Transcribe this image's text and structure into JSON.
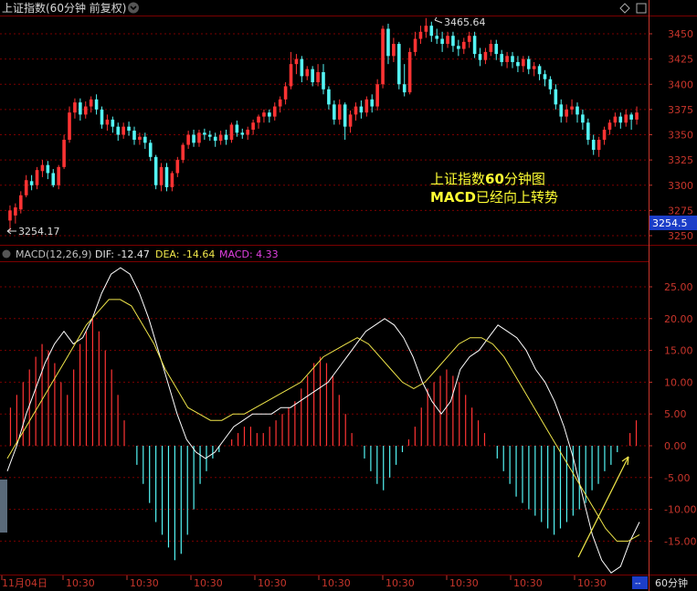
{
  "header": {
    "title": "上证指数(60分钟 前复权)",
    "menu_icon": "chevron-down-icon",
    "diamond_icon": "diamond-icon",
    "box_icon": "square-icon"
  },
  "colors": {
    "up": "#ff3333",
    "down": "#54f5f5",
    "grid": "#7a0000",
    "axis_text": "#c8352b",
    "dif": "#ffffff",
    "dea": "#f0e64a",
    "macd": "#e040e0",
    "annotation": "#ffff33"
  },
  "price_panel": {
    "high_label": "3465.64",
    "low_label": "3254.17",
    "current_price": "3254.5",
    "y_ticks": [
      "3450",
      "3425",
      "3400",
      "3375",
      "3350",
      "3325",
      "3300",
      "3275",
      "3250"
    ]
  },
  "annotation": {
    "line1": "上证指数",
    "line1_bold": "60",
    "line1_end": "分钟图",
    "line2_bold": "MACD",
    "line2_end": "已经向上转势"
  },
  "macd_panel": {
    "title": "MACD(12,26,9)",
    "dif_label": "DIF: -12.47",
    "dea_label": "DEA: -14.64",
    "macd_label": "MACD: 4.33",
    "y_ticks": [
      "25.00",
      "20.00",
      "15.00",
      "10.00",
      "5.00",
      "0.00",
      "-5.00",
      "-10.00",
      "-15.00"
    ]
  },
  "time_axis": {
    "labels": [
      "11月04日",
      "10:30",
      "10:30",
      "10:30",
      "10:30",
      "10:30",
      "10:30",
      "10:30",
      "10:30",
      "10:30"
    ],
    "period": "60分钟"
  },
  "chart_data": [
    {
      "type": "candlestick",
      "title": "上证指数(60分钟 前复权)",
      "ylim": [
        3245,
        3470
      ],
      "candles": [
        [
          3265,
          3275,
          3255,
          3280
        ],
        [
          3270,
          3278,
          3262,
          3282
        ],
        [
          3276,
          3290,
          3272,
          3294
        ],
        [
          3290,
          3305,
          3288,
          3310
        ],
        [
          3304,
          3300,
          3295,
          3310
        ],
        [
          3300,
          3315,
          3296,
          3318
        ],
        [
          3314,
          3320,
          3308,
          3325
        ],
        [
          3320,
          3312,
          3306,
          3324
        ],
        [
          3312,
          3300,
          3298,
          3316
        ],
        [
          3300,
          3318,
          3296,
          3320
        ],
        [
          3318,
          3345,
          3316,
          3350
        ],
        [
          3345,
          3372,
          3342,
          3378
        ],
        [
          3372,
          3382,
          3366,
          3386
        ],
        [
          3382,
          3370,
          3364,
          3386
        ],
        [
          3370,
          3378,
          3366,
          3383
        ],
        [
          3378,
          3385,
          3372,
          3388
        ],
        [
          3385,
          3375,
          3370,
          3390
        ],
        [
          3375,
          3360,
          3356,
          3378
        ],
        [
          3360,
          3365,
          3354,
          3370
        ],
        [
          3365,
          3358,
          3352,
          3368
        ],
        [
          3358,
          3350,
          3344,
          3362
        ],
        [
          3350,
          3358,
          3346,
          3362
        ],
        [
          3358,
          3354,
          3349,
          3363
        ],
        [
          3354,
          3345,
          3340,
          3358
        ],
        [
          3345,
          3348,
          3340,
          3352
        ],
        [
          3348,
          3342,
          3336,
          3352
        ],
        [
          3342,
          3328,
          3324,
          3345
        ],
        [
          3328,
          3300,
          3296,
          3330
        ],
        [
          3300,
          3318,
          3294,
          3322
        ],
        [
          3318,
          3298,
          3294,
          3322
        ],
        [
          3298,
          3312,
          3294,
          3314
        ],
        [
          3312,
          3325,
          3308,
          3328
        ],
        [
          3325,
          3340,
          3322,
          3342
        ],
        [
          3340,
          3350,
          3336,
          3354
        ],
        [
          3350,
          3342,
          3338,
          3355
        ],
        [
          3342,
          3352,
          3338,
          3355
        ],
        [
          3352,
          3350,
          3345,
          3356
        ],
        [
          3350,
          3348,
          3344,
          3354
        ],
        [
          3348,
          3344,
          3338,
          3352
        ],
        [
          3344,
          3350,
          3340,
          3354
        ],
        [
          3350,
          3345,
          3340,
          3355
        ],
        [
          3345,
          3360,
          3342,
          3362
        ],
        [
          3360,
          3352,
          3348,
          3364
        ],
        [
          3352,
          3350,
          3346,
          3356
        ],
        [
          3350,
          3355,
          3345,
          3358
        ],
        [
          3355,
          3362,
          3350,
          3365
        ],
        [
          3362,
          3368,
          3356,
          3370
        ],
        [
          3368,
          3372,
          3362,
          3375
        ],
        [
          3372,
          3368,
          3362,
          3375
        ],
        [
          3368,
          3378,
          3364,
          3382
        ],
        [
          3378,
          3385,
          3372,
          3388
        ],
        [
          3385,
          3398,
          3380,
          3402
        ],
        [
          3398,
          3420,
          3395,
          3432
        ],
        [
          3420,
          3425,
          3410,
          3430
        ],
        [
          3425,
          3408,
          3402,
          3428
        ],
        [
          3408,
          3415,
          3404,
          3418
        ],
        [
          3415,
          3402,
          3398,
          3418
        ],
        [
          3402,
          3412,
          3398,
          3420
        ],
        [
          3412,
          3395,
          3390,
          3420
        ],
        [
          3395,
          3380,
          3375,
          3398
        ],
        [
          3380,
          3365,
          3360,
          3384
        ],
        [
          3365,
          3380,
          3360,
          3385
        ],
        [
          3380,
          3358,
          3345,
          3382
        ],
        [
          3358,
          3370,
          3352,
          3374
        ],
        [
          3370,
          3378,
          3364,
          3382
        ],
        [
          3378,
          3372,
          3366,
          3384
        ],
        [
          3372,
          3385,
          3368,
          3388
        ],
        [
          3385,
          3378,
          3372,
          3390
        ],
        [
          3378,
          3400,
          3374,
          3405
        ],
        [
          3400,
          3455,
          3396,
          3458
        ],
        [
          3455,
          3428,
          3420,
          3460
        ],
        [
          3428,
          3440,
          3422,
          3446
        ],
        [
          3440,
          3400,
          3395,
          3442
        ],
        [
          3400,
          3392,
          3388,
          3420
        ],
        [
          3392,
          3432,
          3390,
          3436
        ],
        [
          3432,
          3445,
          3428,
          3452
        ],
        [
          3445,
          3452,
          3440,
          3458
        ],
        [
          3452,
          3458,
          3446,
          3465.64
        ],
        [
          3458,
          3448,
          3442,
          3462
        ],
        [
          3448,
          3445,
          3440,
          3455
        ],
        [
          3445,
          3440,
          3432,
          3452
        ],
        [
          3440,
          3448,
          3436,
          3452
        ],
        [
          3448,
          3438,
          3432,
          3452
        ],
        [
          3438,
          3435,
          3428,
          3444
        ],
        [
          3435,
          3442,
          3430,
          3446
        ],
        [
          3442,
          3448,
          3436,
          3452
        ],
        [
          3448,
          3430,
          3426,
          3452
        ],
        [
          3430,
          3424,
          3418,
          3436
        ],
        [
          3424,
          3432,
          3420,
          3436
        ],
        [
          3432,
          3440,
          3428,
          3444
        ],
        [
          3440,
          3430,
          3424,
          3444
        ],
        [
          3430,
          3422,
          3418,
          3434
        ],
        [
          3422,
          3428,
          3416,
          3432
        ],
        [
          3428,
          3422,
          3416,
          3432
        ],
        [
          3422,
          3418,
          3412,
          3428
        ],
        [
          3418,
          3425,
          3412,
          3428
        ],
        [
          3425,
          3415,
          3410,
          3428
        ],
        [
          3415,
          3418,
          3408,
          3422
        ],
        [
          3418,
          3410,
          3404,
          3420
        ],
        [
          3410,
          3405,
          3398,
          3414
        ],
        [
          3405,
          3395,
          3390,
          3408
        ],
        [
          3395,
          3380,
          3375,
          3400
        ],
        [
          3380,
          3368,
          3362,
          3385
        ],
        [
          3368,
          3375,
          3362,
          3380
        ],
        [
          3375,
          3378,
          3370,
          3385
        ],
        [
          3378,
          3370,
          3362,
          3382
        ],
        [
          3370,
          3362,
          3355,
          3375
        ],
        [
          3362,
          3345,
          3340,
          3366
        ],
        [
          3345,
          3335,
          3330,
          3350
        ],
        [
          3335,
          3345,
          3328,
          3348
        ],
        [
          3345,
          3355,
          3340,
          3358
        ],
        [
          3355,
          3362,
          3350,
          3365
        ],
        [
          3362,
          3368,
          3358,
          3372
        ],
        [
          3368,
          3362,
          3356,
          3372
        ],
        [
          3362,
          3370,
          3358,
          3375
        ],
        [
          3370,
          3365,
          3355,
          3372
        ],
        [
          3365,
          3372,
          3360,
          3378
        ]
      ]
    },
    {
      "type": "bar+line",
      "title": "MACD(12,26,9)",
      "ylim": [
        -20,
        30
      ],
      "series": [
        {
          "name": "MACD",
          "values": [
            6,
            8,
            10,
            12,
            14,
            16,
            15,
            13,
            10,
            8,
            12,
            16,
            18,
            20,
            18,
            15,
            12,
            8,
            4,
            0,
            -3,
            -6,
            -9,
            -12,
            -14,
            -16,
            -18,
            -17,
            -14,
            -10,
            -6,
            -4,
            -2,
            -1,
            0,
            1,
            2,
            3,
            3,
            2,
            2,
            3,
            4,
            5,
            6,
            7,
            9,
            11,
            13,
            14,
            13,
            11,
            8,
            5,
            2,
            0,
            -2,
            -4,
            -6,
            -7,
            -5,
            -3,
            -1,
            1,
            3,
            6,
            9,
            10,
            11,
            12,
            11,
            10,
            8,
            6,
            4,
            2,
            0,
            -2,
            -4,
            -6,
            -8,
            -9,
            -10,
            -11,
            -12,
            -13,
            -14,
            -13,
            -12,
            -11,
            -10,
            -9,
            -7,
            -6,
            -4,
            -3,
            -1,
            0,
            2,
            4
          ]
        },
        {
          "name": "DIF",
          "values": [
            -4,
            0,
            5,
            9,
            13,
            16,
            18,
            16,
            17,
            20,
            24,
            27,
            28,
            27,
            24,
            20,
            15,
            10,
            5,
            1,
            -1,
            -2,
            -1,
            1,
            3,
            4,
            5,
            5,
            5,
            6,
            6,
            7,
            8,
            9,
            10,
            12,
            14,
            16,
            18,
            19,
            20,
            19,
            17,
            14,
            10,
            7,
            5,
            7,
            12,
            14,
            15,
            17,
            19,
            18,
            17,
            15,
            12,
            10,
            7,
            3,
            -2,
            -8,
            -14,
            -18,
            -20,
            -19,
            -15,
            -12
          ]
        },
        {
          "name": "DEA",
          "values": [
            -2,
            1,
            4,
            7,
            10,
            13,
            16,
            19,
            21,
            23,
            23,
            22,
            19,
            16,
            12,
            9,
            6,
            5,
            4,
            4,
            5,
            5,
            6,
            7,
            8,
            9,
            10,
            12,
            14,
            15,
            16,
            17,
            16,
            14,
            12,
            10,
            9,
            10,
            12,
            14,
            16,
            17,
            17,
            16,
            14,
            11,
            8,
            5,
            2,
            -1,
            -4,
            -7,
            -10,
            -13,
            -15,
            -15,
            -14
          ]
        }
      ]
    }
  ]
}
